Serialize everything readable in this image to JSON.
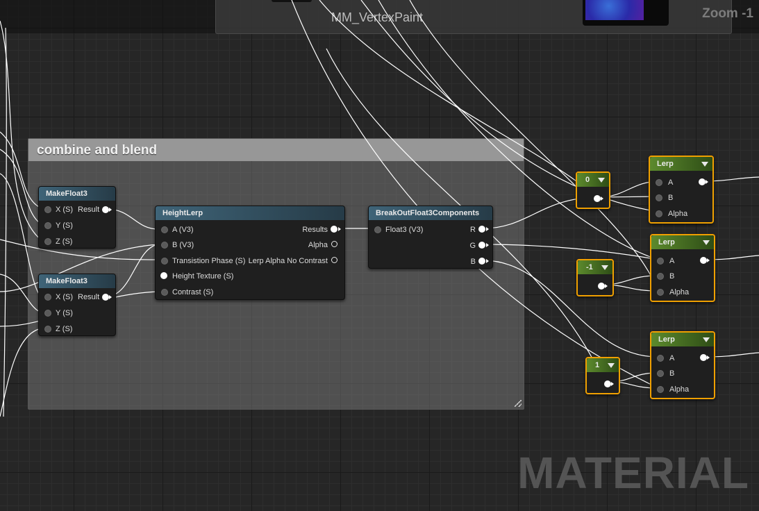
{
  "material": {
    "title": "MM_VertexPaint"
  },
  "zoom_label": "Zoom -1",
  "watermark": "MATERIAL",
  "comment": {
    "title": "combine and blend"
  },
  "nodes": {
    "makefloat3_top": {
      "title": "MakeFloat3",
      "pins": {
        "x": "X (S)",
        "y": "Y (S)",
        "z": "Z (S)",
        "result": "Result"
      }
    },
    "makefloat3_bottom": {
      "title": "MakeFloat3",
      "pins": {
        "x": "X (S)",
        "y": "Y (S)",
        "z": "Z (S)",
        "result": "Result"
      }
    },
    "heightlerp": {
      "title": "HeightLerp",
      "inputs": [
        "A (V3)",
        "B (V3)",
        "Transistion Phase (S)",
        "Height Texture (S)",
        "Contrast (S)"
      ],
      "outputs": [
        "Results",
        "Alpha",
        "Lerp Alpha No Contrast"
      ]
    },
    "breakout": {
      "title": "BreakOutFloat3Components",
      "input": "Float3 (V3)",
      "outputs": [
        "R",
        "G",
        "B"
      ]
    },
    "const_0": {
      "value": "0"
    },
    "const_neg1": {
      "value": "-1"
    },
    "const_1": {
      "value": "1"
    },
    "lerp_1": {
      "title": "Lerp",
      "pins": [
        "A",
        "B",
        "Alpha"
      ]
    },
    "lerp_2": {
      "title": "Lerp",
      "pins": [
        "A",
        "B",
        "Alpha"
      ]
    },
    "lerp_3": {
      "title": "Lerp",
      "pins": [
        "A",
        "B",
        "Alpha"
      ]
    }
  },
  "colors": {
    "header_blue": "#3f6478",
    "header_green": "#5c8a2d",
    "selection": "#f0a000",
    "wire": "#ffffff"
  }
}
